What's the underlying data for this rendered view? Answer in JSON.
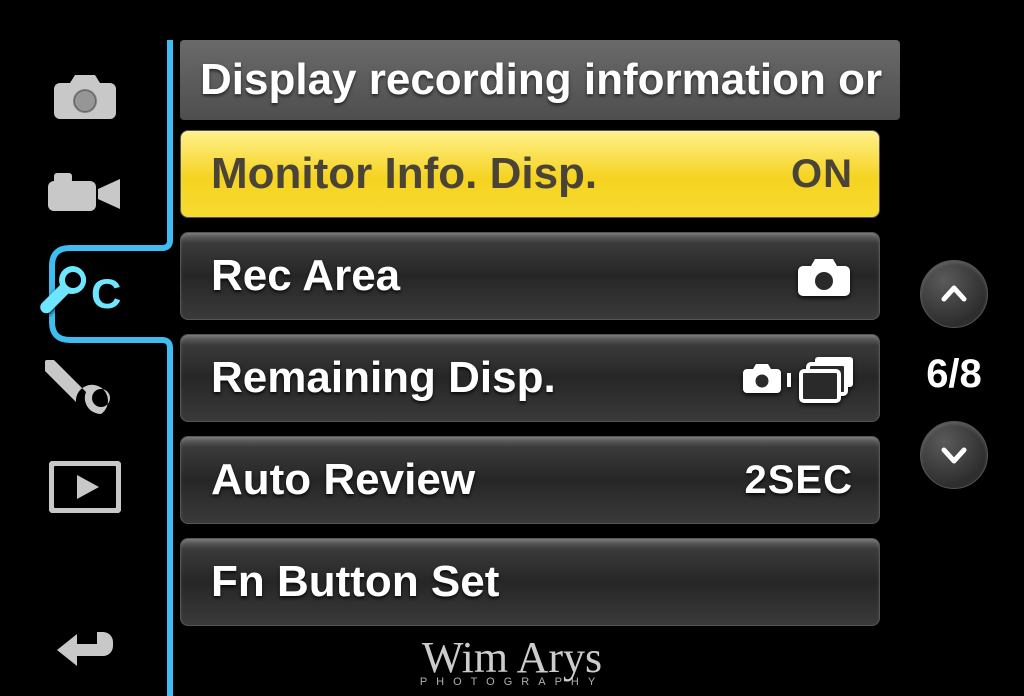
{
  "header": {
    "title": "Display recording information or"
  },
  "sidebar": {
    "tabs": [
      {
        "id": "rec",
        "icon": "camera-icon"
      },
      {
        "id": "movie",
        "icon": "camcorder-icon"
      },
      {
        "id": "custom",
        "icon": "wrench-c-icon",
        "active": true
      },
      {
        "id": "setup",
        "icon": "wrench-icon"
      },
      {
        "id": "playback",
        "icon": "play-icon"
      }
    ]
  },
  "menu": {
    "items": [
      {
        "label": "Monitor Info. Disp.",
        "value": "ON",
        "selected": true,
        "valueType": "text"
      },
      {
        "label": "Rec Area",
        "value": "camera",
        "valueType": "icon"
      },
      {
        "label": "Remaining Disp.",
        "value": "camera-burst",
        "valueType": "icon"
      },
      {
        "label": "Auto Review",
        "value": "2SEC",
        "valueType": "text"
      },
      {
        "label": "Fn Button Set",
        "value": "",
        "valueType": "none"
      }
    ]
  },
  "page": {
    "current": 6,
    "total": 8,
    "display": "6/8"
  },
  "back": {
    "label": "Back"
  },
  "watermark": {
    "signature": "Wim Arys",
    "sub": "PHOTOGRAPHY"
  }
}
